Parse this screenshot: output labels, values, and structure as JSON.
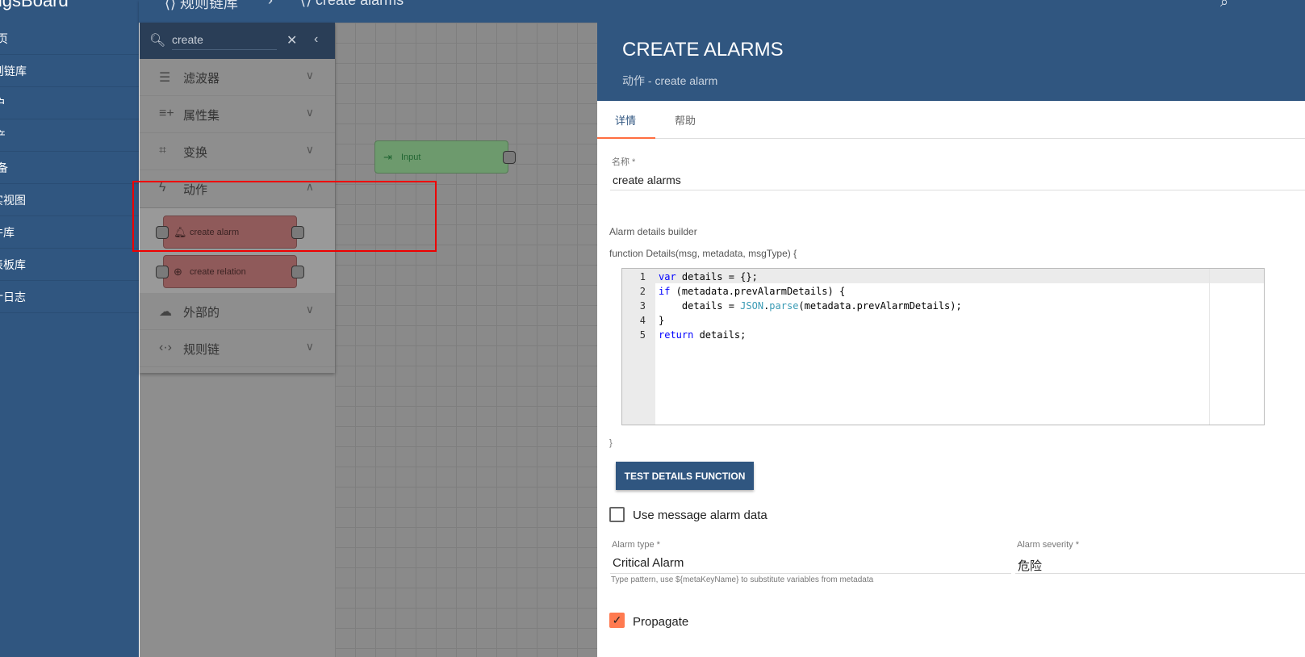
{
  "sidebar": {
    "brand": "ThingsBoard",
    "items": [
      "页",
      "则链库",
      "户",
      "产",
      "备",
      "实视图",
      "件库",
      "表板库",
      "计日志"
    ]
  },
  "topbar": {
    "crumb1": "⟨⟩ 规则链库",
    "sep": "›",
    "crumb2": "⟨⟩ create alarms"
  },
  "library": {
    "search_value": "create",
    "categories": [
      {
        "label": "滤波器",
        "icon": "filter-icon",
        "expanded": false
      },
      {
        "label": "属性集",
        "icon": "playlist-add-icon",
        "expanded": false
      },
      {
        "label": "变换",
        "icon": "crop-icon",
        "expanded": false
      },
      {
        "label": "动作",
        "icon": "flash-icon",
        "expanded": true
      },
      {
        "label": "外部的",
        "icon": "cloud-upload-icon",
        "expanded": false
      },
      {
        "label": "规则链",
        "icon": "code-icon",
        "expanded": false
      }
    ],
    "nodes": [
      {
        "label": "create alarm",
        "icon": "alarm-bell-icon"
      },
      {
        "label": "create relation",
        "icon": "add-circle-icon"
      }
    ]
  },
  "canvas": {
    "input_node": "Input"
  },
  "panel": {
    "title": "CREATE ALARMS",
    "subtitle": "动作 - create alarm",
    "tabs": [
      "详情",
      "帮助"
    ],
    "name_label": "名称 *",
    "name_value": "create alarms",
    "builder_label": "Alarm details builder",
    "fn_sig": "function Details(msg, metadata, msgType) {",
    "fn_close": "}",
    "code_lines": [
      "1",
      "2",
      "3",
      "4",
      "5"
    ],
    "test_button": "TEST DETAILS FUNCTION",
    "use_msg_alarm": "Use message alarm data",
    "use_msg_alarm_checked": false,
    "alarm_type_label": "Alarm type *",
    "alarm_type_value": "Critical  Alarm",
    "alarm_type_hint": "Type pattern, use ${metaKeyName} to substitute variables from metadata",
    "severity_label": "Alarm severity *",
    "severity_value": "危险",
    "propagate": "Propagate",
    "propagate_checked": true
  },
  "colors": {
    "primary": "#305680",
    "accent": "#ff6e40"
  }
}
